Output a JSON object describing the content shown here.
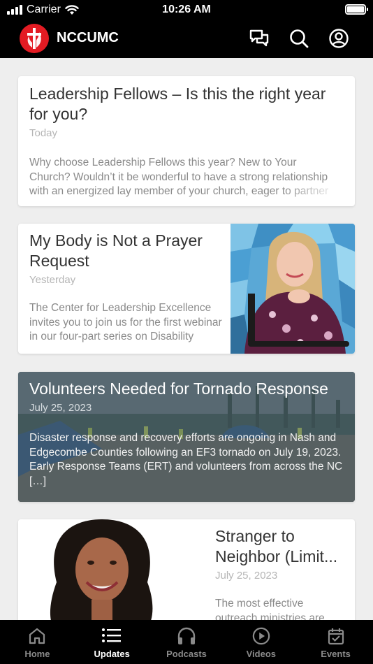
{
  "status_bar": {
    "carrier": "Carrier",
    "time": "10:26 AM"
  },
  "header": {
    "brand": "NCCUMC",
    "icons": [
      "chat-bubbles-icon",
      "search-icon",
      "account-icon"
    ],
    "brand_color": "#e31b23"
  },
  "feed": [
    {
      "title": "Leadership Fellows – Is this the right year for you?",
      "date": "Today",
      "excerpt_lines": [
        "Why choose Leadership Fellows this year? New to Your",
        "Church? Wouldn’t it be wonderful to have a strong relationship",
        "with an energized lay member of your church, eager to partner"
      ]
    },
    {
      "title": "My Body is Not a Prayer Request",
      "date": "Yesterday",
      "excerpt": "The Center for Leadership Excellence invites you to join us for the first webinar in our four-part series on Disability"
    },
    {
      "title": "Volunteers Needed for Tornado Response",
      "date": "July 25, 2023",
      "excerpt": "Disaster response and recovery efforts are ongoing in Nash and Edgecombe Counties following an EF3 tornado on July 19, 2023. Early Response Teams (ERT) and volunteers from across the NC […]"
    },
    {
      "title_lines": [
        "Stranger to",
        "Neighbor (Limit..."
      ],
      "date": "July 25, 2023",
      "excerpt": "The most effective outreach ministries are"
    }
  ],
  "tabs": [
    {
      "label": "Home",
      "icon": "home-icon",
      "active": false
    },
    {
      "label": "Updates",
      "icon": "list-icon",
      "active": true
    },
    {
      "label": "Podcasts",
      "icon": "headphones-icon",
      "active": false
    },
    {
      "label": "Videos",
      "icon": "play-circle-icon",
      "active": false
    },
    {
      "label": "Events",
      "icon": "calendar-check-icon",
      "active": false
    }
  ]
}
